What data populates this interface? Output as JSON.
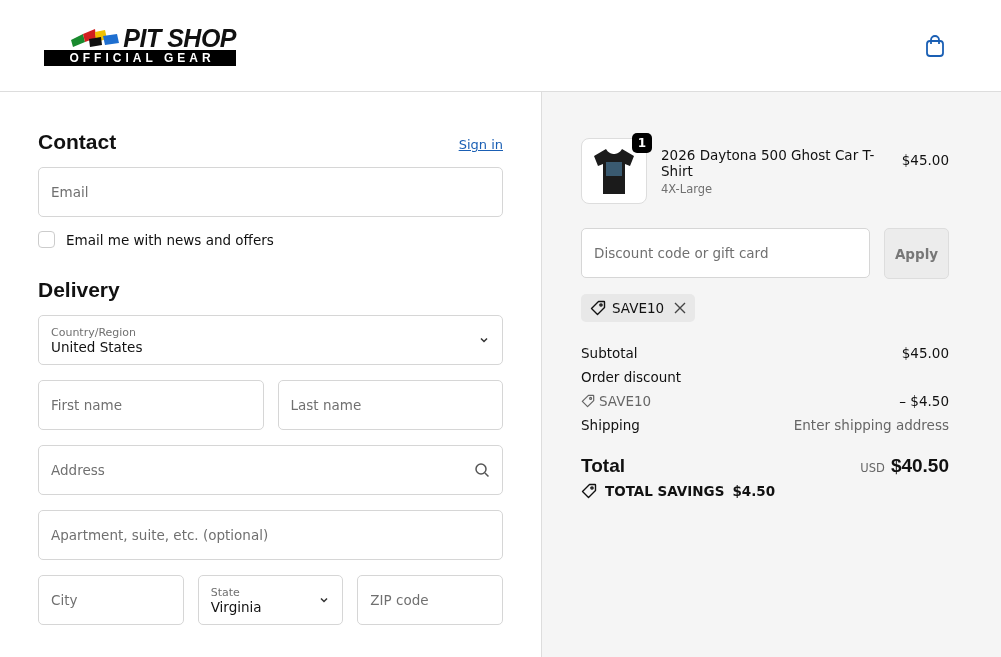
{
  "header": {
    "logo": {
      "title": "PIT SHOP",
      "subtitle": "OFFICIAL GEAR"
    }
  },
  "contact": {
    "title": "Contact",
    "sign_in": "Sign in",
    "email": {
      "placeholder": "Email"
    },
    "newsletter": {
      "label": "Email me with news and offers",
      "checked": false
    }
  },
  "delivery": {
    "title": "Delivery",
    "rows": [
      [
        {
          "kind": "select",
          "label": "Country/Region",
          "value": "United States"
        }
      ],
      [
        {
          "kind": "text",
          "placeholder": "First name"
        },
        {
          "kind": "text",
          "placeholder": "Last name"
        }
      ],
      [
        {
          "kind": "search",
          "placeholder": "Address"
        }
      ],
      [
        {
          "kind": "text",
          "placeholder": "Apartment, suite, etc. (optional)"
        }
      ],
      [
        {
          "kind": "text",
          "placeholder": "City"
        },
        {
          "kind": "select",
          "label": "State",
          "value": "Virginia"
        },
        {
          "kind": "text",
          "placeholder": "ZIP code"
        }
      ]
    ]
  },
  "summary": {
    "items": [
      {
        "name": "2026 Daytona 500 Ghost Car T-Shirt",
        "variant": "4X-Large",
        "price": "$45.00",
        "quantity": "1"
      }
    ],
    "discount": {
      "placeholder": "Discount code or gift card",
      "button": "Apply",
      "applied": [
        {
          "code": "SAVE10"
        }
      ]
    },
    "lines": [
      {
        "kind": "amount",
        "label": "Subtotal",
        "value": "$45.00"
      },
      {
        "kind": "heading",
        "label": "Order discount"
      },
      {
        "kind": "code",
        "label": "SAVE10",
        "value": "– $4.50"
      },
      {
        "kind": "muted",
        "label": "Shipping",
        "value": "Enter shipping address"
      }
    ],
    "total": {
      "label": "Total",
      "currency": "USD",
      "value": "$40.50"
    },
    "savings": {
      "label": "TOTAL SAVINGS",
      "value": "$4.50"
    }
  }
}
